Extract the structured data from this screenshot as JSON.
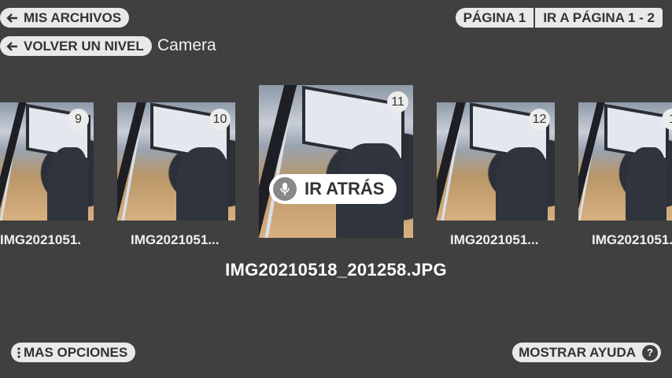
{
  "header": {
    "my_files_label": "MIS ARCHIVOS",
    "up_level_label": "VOLVER UN NIVEL",
    "folder_name": "Camera",
    "page_label": "PÁGINA 1",
    "go_to_page_label": "IR A PÁGINA 1 - 2"
  },
  "gallery": {
    "items": [
      {
        "number": "9",
        "caption": "IMG2021051..."
      },
      {
        "number": "10",
        "caption": "IMG2021051..."
      },
      {
        "number": "11",
        "caption": ""
      },
      {
        "number": "12",
        "caption": "IMG2021051..."
      },
      {
        "number": "1",
        "caption": "IMG2021051..."
      }
    ],
    "selected_filename": "IMG20210518_201258.JPG",
    "voice_hint": "IR ATRÁS"
  },
  "footer": {
    "more_options_label": "MAS OPCIONES",
    "show_help_label": "MOSTRAR AYUDA",
    "help_glyph": "?"
  },
  "colors": {
    "background": "#404040",
    "pill": "#e9e9e9"
  }
}
